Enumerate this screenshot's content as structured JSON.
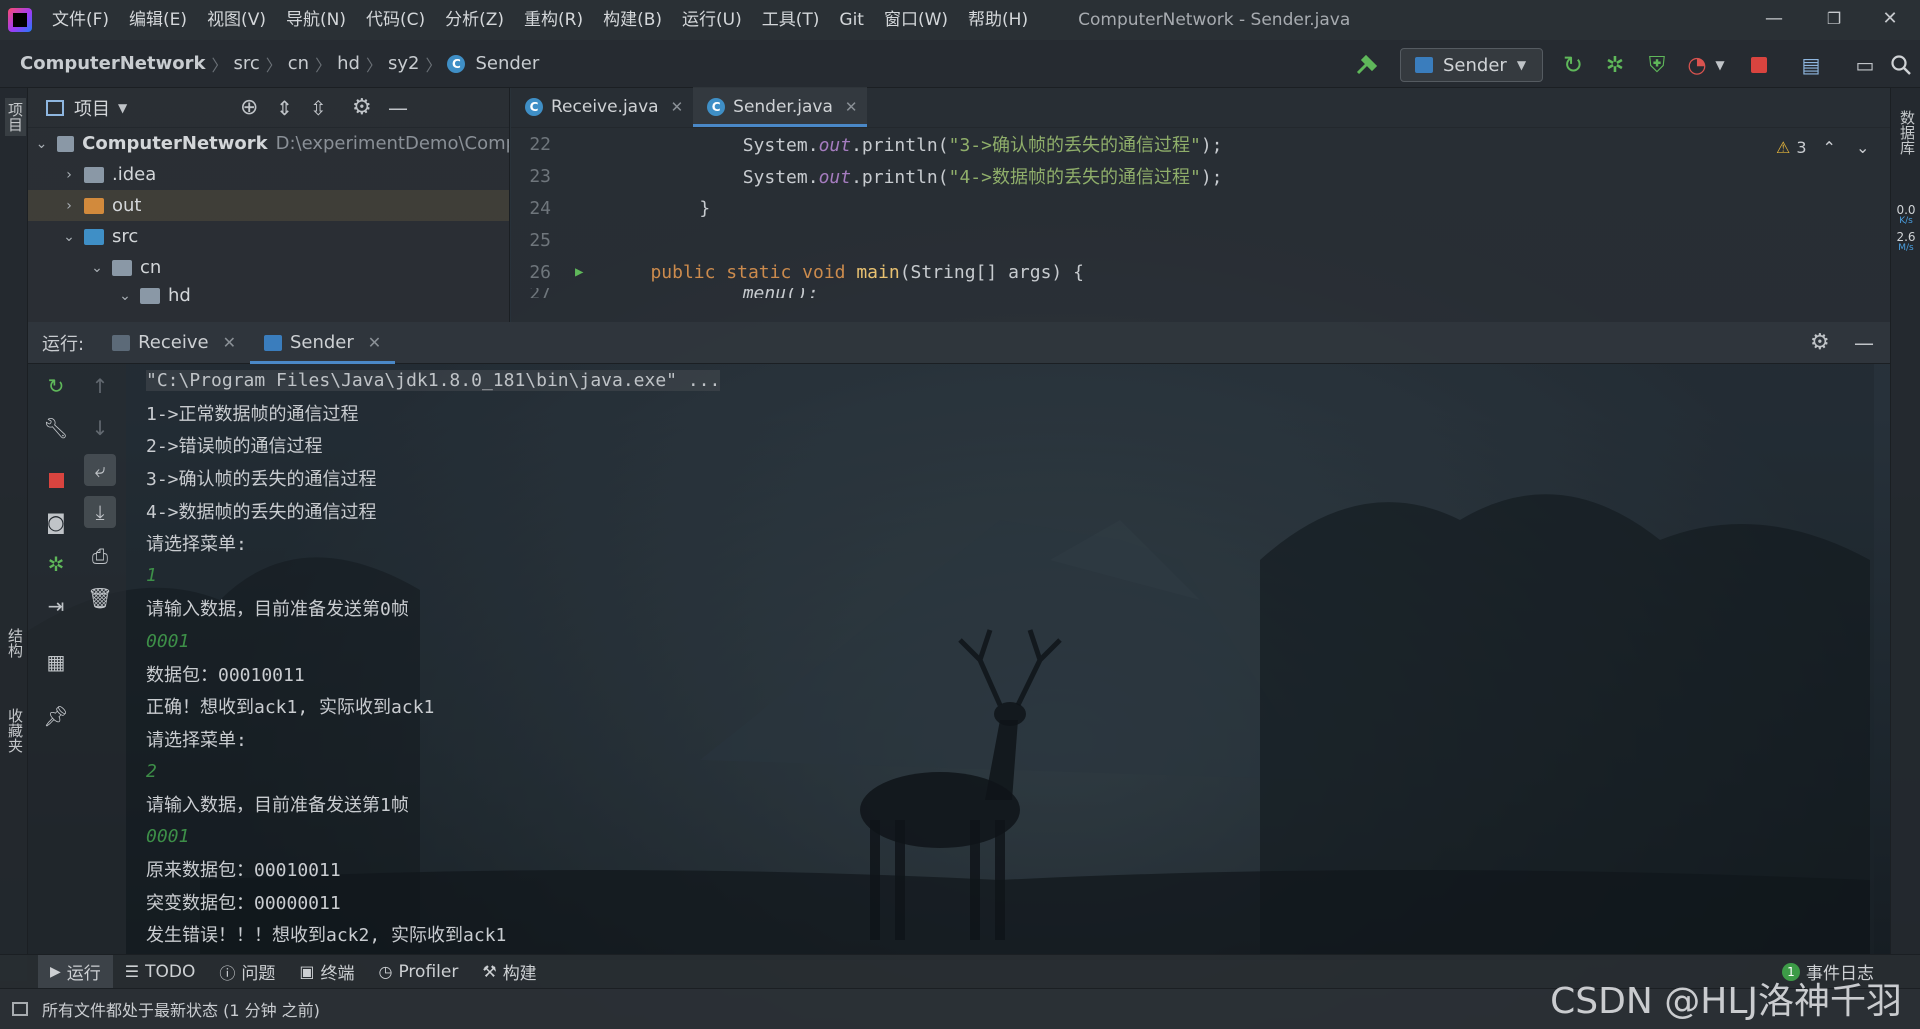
{
  "titlebar": {
    "menu": [
      "文件(F)",
      "编辑(E)",
      "视图(V)",
      "导航(N)",
      "代码(C)",
      "分析(Z)",
      "重构(R)",
      "构建(B)",
      "运行(U)",
      "工具(T)",
      "Git",
      "窗口(W)",
      "帮助(H)"
    ],
    "window_title": "ComputerNetwork - Sender.java",
    "minimize": "—",
    "restore": "❐",
    "close": "✕"
  },
  "navbar": {
    "breadcrumbs": [
      "ComputerNetwork",
      "src",
      "cn",
      "hd",
      "sy2",
      "Sender"
    ],
    "run_config": "Sender"
  },
  "left_stripe": {
    "project": "项目",
    "structure": "结构",
    "favorites": "收藏夹"
  },
  "project_panel": {
    "title": "项目",
    "tree": [
      {
        "label": "ComputerNetwork",
        "path": "D:\\experimentDemo\\Compute",
        "expanded": true
      },
      {
        "label": ".idea",
        "expanded": false
      },
      {
        "label": "out",
        "expanded": false
      },
      {
        "label": "src",
        "expanded": true
      },
      {
        "label": "cn",
        "expanded": true
      },
      {
        "label": "hd",
        "expanded": true
      }
    ]
  },
  "editor": {
    "tabs": [
      {
        "label": "Receive.java",
        "active": false
      },
      {
        "label": "Sender.java",
        "active": true
      }
    ],
    "warning_count": "3",
    "lines": [
      {
        "n": "22",
        "indent": "        ",
        "pre": "System.",
        "field": "out",
        "mid": ".println(",
        "str": "\"3->确认帧的丢失的通信过程\"",
        "post": ");"
      },
      {
        "n": "23",
        "indent": "        ",
        "pre": "System.",
        "field": "out",
        "mid": ".println(",
        "str": "\"4->数据帧的丢失的通信过程\"",
        "post": ");"
      },
      {
        "n": "24",
        "text": "    }"
      },
      {
        "n": "25",
        "text": ""
      },
      {
        "n": "26",
        "kw": "public static void ",
        "fn": "main",
        "rest": "(String[] args) {"
      },
      {
        "n": "27",
        "text": "        menu();"
      }
    ]
  },
  "right_stripe": {
    "database": "数据库",
    "net_up": "0.0",
    "net_up_unit": "K/s",
    "net_down": "2.6",
    "net_down_unit": "M/s"
  },
  "run_panel": {
    "label": "运行:",
    "tabs": [
      {
        "label": "Receive",
        "active": false
      },
      {
        "label": "Sender",
        "active": true
      }
    ],
    "console": [
      {
        "type": "cmd",
        "text": "\"C:\\Program Files\\Java\\jdk1.8.0_181\\bin\\java.exe\" ..."
      },
      {
        "type": "out",
        "text": "1->正常数据帧的通信过程"
      },
      {
        "type": "out",
        "text": "2->错误帧的通信过程"
      },
      {
        "type": "out",
        "text": "3->确认帧的丢失的通信过程"
      },
      {
        "type": "out",
        "text": "4->数据帧的丢失的通信过程"
      },
      {
        "type": "out",
        "text": "请选择菜单:"
      },
      {
        "type": "input",
        "text": "1"
      },
      {
        "type": "out",
        "text": "请输入数据，目前准备发送第0帧"
      },
      {
        "type": "input",
        "text": "0001"
      },
      {
        "type": "out",
        "text": "数据包：00010011"
      },
      {
        "type": "out",
        "text": "正确！想收到ack1, 实际收到ack1"
      },
      {
        "type": "out",
        "text": "请选择菜单:"
      },
      {
        "type": "input",
        "text": "2"
      },
      {
        "type": "out",
        "text": "请输入数据，目前准备发送第1帧"
      },
      {
        "type": "input",
        "text": "0001"
      },
      {
        "type": "out",
        "text": "原来数据包：00010011"
      },
      {
        "type": "out",
        "text": "突变数据包：00000011"
      },
      {
        "type": "out",
        "text": "发生错误！！！想收到ack2, 实际收到ack1"
      }
    ]
  },
  "bottom_tabs": [
    {
      "label": "运行",
      "icon": "play-icon",
      "active": true
    },
    {
      "label": "TODO",
      "icon": "list-icon",
      "active": false
    },
    {
      "label": "问题",
      "icon": "info-icon",
      "active": false
    },
    {
      "label": "终端",
      "icon": "terminal-icon",
      "active": false
    },
    {
      "label": "Profiler",
      "icon": "profiler-icon",
      "active": false
    },
    {
      "label": "构建",
      "icon": "hammer-icon",
      "active": false
    }
  ],
  "event_log": {
    "count": "1",
    "label": "事件日志"
  },
  "status_bar": {
    "text": "所有文件都处于最新状态 (1 分钟 之前)"
  },
  "watermark": "CSDN @HLJ洛神千羽"
}
